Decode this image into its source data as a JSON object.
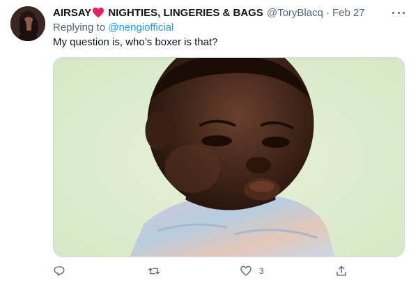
{
  "tweet": {
    "author": {
      "name_part1": "AIRSAY",
      "name_part2": "NIGHTIES, LINGERIES & BAGS",
      "handle": "@ToryBlacq",
      "separator": "·",
      "date": "Feb 27",
      "emoji_icon": "heart-icon",
      "emoji_color": "#e0245e"
    },
    "replying_to": {
      "prefix": "Replying to",
      "mention": "@nengiofficial"
    },
    "text": "My question is, who’s boxer is that?",
    "actions": {
      "reply_icon": "reply-icon",
      "retweet_icon": "retweet-icon",
      "like_icon": "heart-outline-icon",
      "like_count": "3",
      "share_icon": "share-icon"
    },
    "colors": {
      "link": "#1d9bf0",
      "secondary_text": "#536471",
      "media_background": "#dfedd0"
    }
  }
}
